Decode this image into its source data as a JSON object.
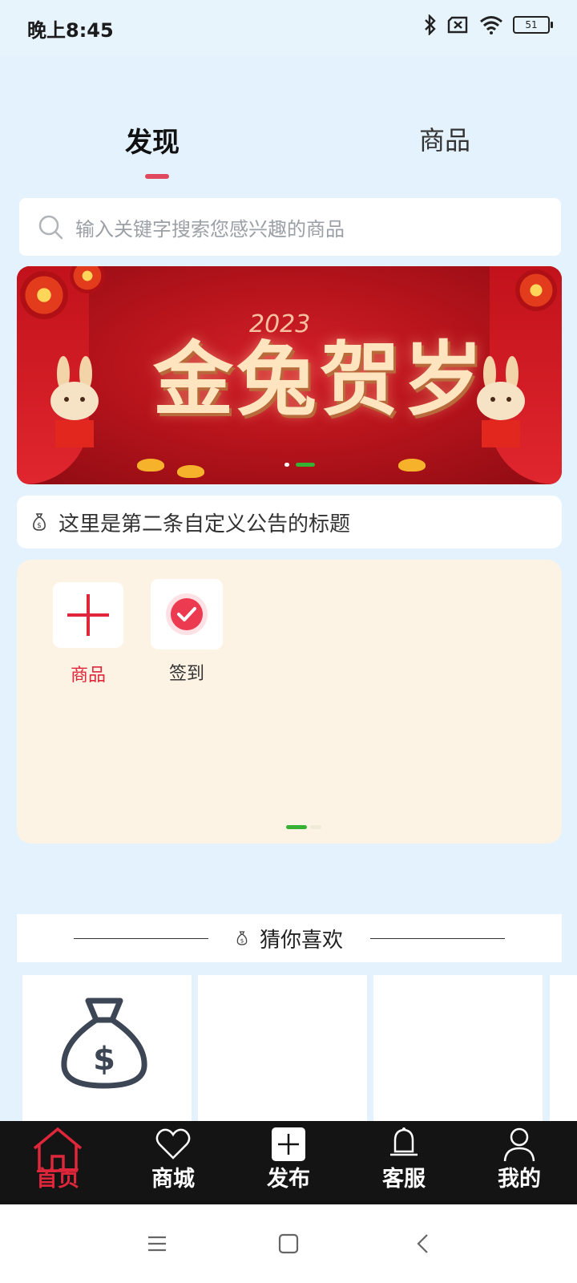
{
  "status_bar": {
    "time": "晚上8:45",
    "battery": "51"
  },
  "tabs": {
    "discover": "发现",
    "goods": "商品"
  },
  "search": {
    "placeholder": "输入关键字搜索您感兴趣的商品"
  },
  "banner": {
    "title": "金兔贺岁",
    "year": "2023"
  },
  "notice": {
    "text": "这里是第二条自定义公告的标题"
  },
  "grid": [
    {
      "label": "商品",
      "icon": "plus-icon",
      "color": "#e0263a"
    },
    {
      "label": "签到",
      "icon": "check-icon",
      "color": "#333333"
    }
  ],
  "guess": {
    "title": "猜你喜欢"
  },
  "bottom_nav": [
    {
      "label": "首页",
      "icon": "home-icon",
      "active": true
    },
    {
      "label": "商城",
      "icon": "heart-icon"
    },
    {
      "label": "发布",
      "icon": "plus-box-icon"
    },
    {
      "label": "客服",
      "icon": "bell-icon"
    },
    {
      "label": "我的",
      "icon": "user-icon"
    }
  ],
  "colors": {
    "accent": "#e0263a",
    "tab_indicator": "#e0485e",
    "indicator_green": "#35b234"
  }
}
